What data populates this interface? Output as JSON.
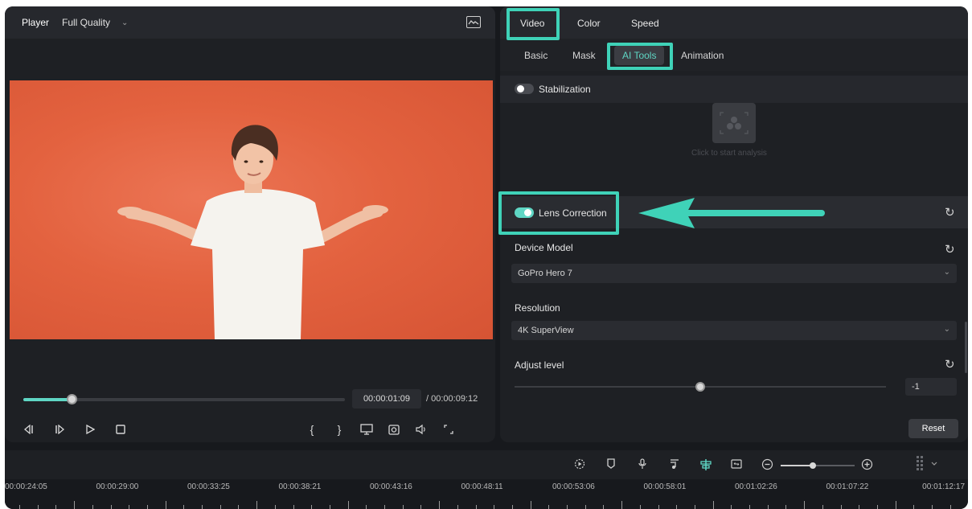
{
  "player": {
    "title": "Player",
    "quality": "Full Quality",
    "current_time": "00:00:01:09",
    "total_time": "/ 00:00:09:12",
    "progress": 0.15
  },
  "tabs": {
    "primary": [
      "Video",
      "Color",
      "Speed"
    ],
    "active_primary": "Video",
    "secondary": [
      "Basic",
      "Mask",
      "AI Tools",
      "Animation"
    ],
    "active_secondary": "AI Tools"
  },
  "panel": {
    "stabilization": {
      "label": "Stabilization",
      "enabled": false
    },
    "analysis_hint": "Click to start analysis",
    "lens_correction": {
      "label": "Lens Correction",
      "enabled": true
    },
    "device_model": {
      "label": "Device Model",
      "value": "GoPro Hero 7"
    },
    "resolution": {
      "label": "Resolution",
      "value": "4K SuperView"
    },
    "adjust_level": {
      "label": "Adjust level",
      "value": "-1",
      "level": 0.5
    },
    "reset_label": "Reset"
  },
  "timeline": {
    "ticks": [
      "00:00:24:05",
      "00:00:29:00",
      "00:00:33:25",
      "00:00:38:21",
      "00:00:43:16",
      "00:00:48:11",
      "00:00:53:06",
      "00:00:58:01",
      "00:01:02:26",
      "00:01:07:22",
      "00:01:12:17"
    ],
    "zoom_level": 0.43
  },
  "colors": {
    "accent": "#5fd6c4",
    "highlight": "#3fd2b8",
    "background": "#1e2024",
    "video_bg": "#e3623f"
  },
  "icons": {
    "player_controls": [
      "prev-frame-icon",
      "next-frame-icon",
      "play-icon",
      "stop-icon"
    ],
    "player_tools": [
      "mark-in-icon",
      "mark-out-icon",
      "display-icon",
      "snapshot-icon",
      "volume-icon",
      "fullscreen-icon"
    ],
    "timeline_tools": [
      "render-icon",
      "marker-icon",
      "mic-icon",
      "music-icon",
      "snap-icon",
      "fit-icon",
      "zoom-out-icon",
      "zoom-in-icon",
      "grid-icon"
    ]
  }
}
